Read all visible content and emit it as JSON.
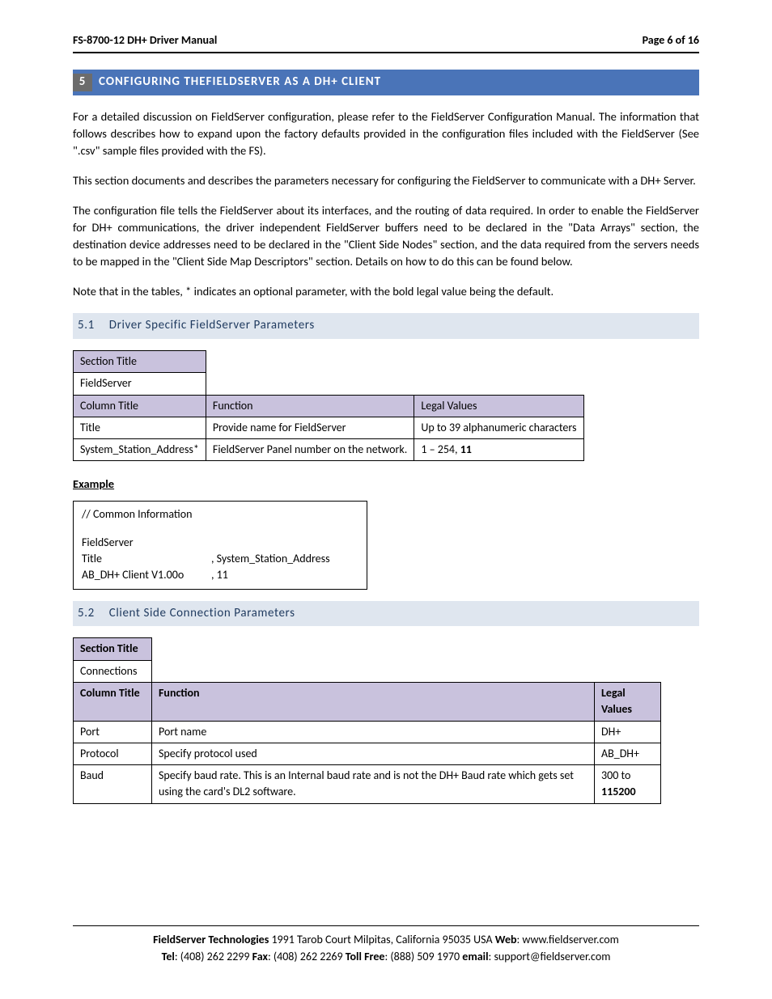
{
  "header": {
    "left": "FS-8700-12 DH+ Driver Manual",
    "right": "Page 6 of 16"
  },
  "section": {
    "num": "5",
    "title": "CONFIGURING THEFIELDSERVER AS A DH+ CLIENT"
  },
  "para1": "For a detailed discussion on FieldServer configuration, please refer to the FieldServer Configuration Manual. The information that follows describes how to expand upon the factory defaults provided in the configuration files included with the FieldServer (See \".csv\" sample files provided with the FS).",
  "para2": "This section documents and describes the parameters necessary for configuring the FieldServer to communicate with a DH+ Server.",
  "para3": "The configuration file tells the FieldServer about its interfaces, and the routing of data required. In order to enable the FieldServer for DH+ communications, the driver independent FieldServer buffers need to be declared in the \"Data Arrays\" section, the destination device addresses need to be declared in the \"Client Side Nodes\" section, and the data required from the servers needs to be mapped in the \"Client Side Map Descriptors\" section.  Details on how to do this can be found below.",
  "para4": "Note that in the tables, * indicates an optional parameter, with the bold legal value being the default.",
  "sub1": {
    "num": "5.1",
    "title": "Driver Specific FieldServer Parameters"
  },
  "t1": {
    "sectionTitleLabel": "Section Title",
    "sectionTitleValue": "FieldServer",
    "h_col": "Column Title",
    "h_func": "Function",
    "h_legal": "Legal Values",
    "r1c1": "Title",
    "r1c2": "Provide name for FieldServer",
    "r1c3": "Up to 39 alphanumeric characters",
    "r2c1": "System_Station_Address*",
    "r2c2": "FieldServer Panel number on the network.",
    "r2c3a": "1 – 254, ",
    "r2c3b": "11"
  },
  "exampleLabel": "Example",
  "example": {
    "l1": "//    Common Information",
    "l2": "FieldServer",
    "l3a": "Title",
    "l3b": ", System_Station_Address",
    "l4a": "AB_DH+ Client V1.00o",
    "l4b": ", 11"
  },
  "sub2": {
    "num": "5.2",
    "title": "Client Side Connection Parameters"
  },
  "t2": {
    "sectionTitleLabel": "Section Title",
    "sectionTitleValue": "Connections",
    "h_col": "Column Title",
    "h_func": "Function",
    "h_legal": "Legal Values",
    "r1c1": "Port",
    "r1c2": "Port name",
    "r1c3": "DH+",
    "r2c1": "Protocol",
    "r2c2": "Specify protocol used",
    "r2c3": "AB_DH+",
    "r3c1": "Baud",
    "r3c2": "Specify baud rate.  This is an Internal baud rate and is not the DH+ Baud rate which gets set using the card's DL2 software.",
    "r3c3a": "300 to ",
    "r3c3b": "115200"
  },
  "footer": {
    "company": "FieldServer Technologies",
    "addr": " 1991 Tarob Court Milpitas, California 95035 USA   ",
    "webLabel": "Web",
    "webVal": ": www.fieldserver.com",
    "telLabel": "Tel",
    "telVal": ": (408) 262 2299   ",
    "faxLabel": "Fax",
    "faxVal": ": (408) 262 2269   ",
    "tollLabel": "Toll Free",
    "tollVal": ": (888) 509 1970   ",
    "emailLabel": "email",
    "emailVal": ": support@fieldserver.com"
  }
}
